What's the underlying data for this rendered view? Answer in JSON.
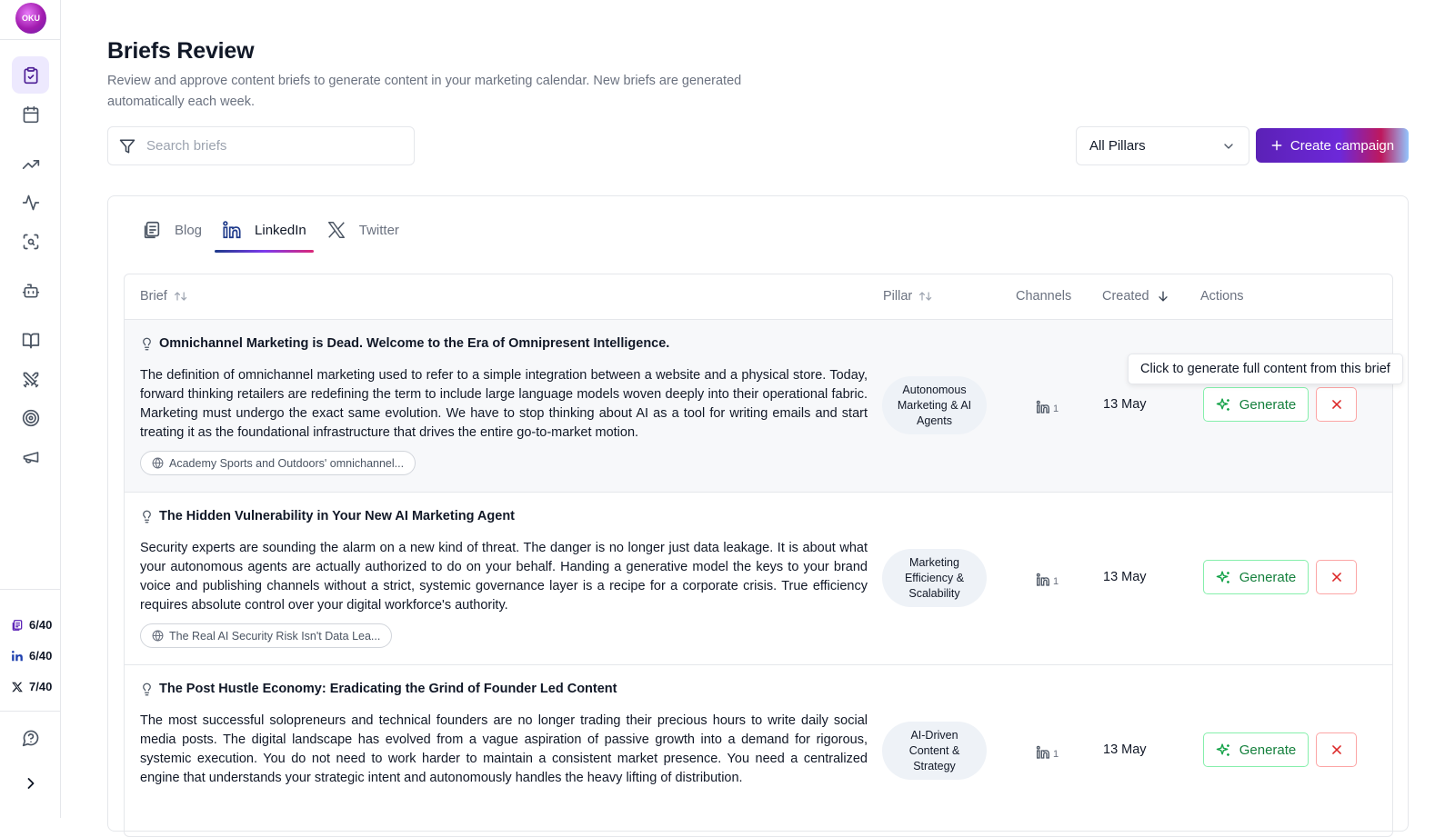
{
  "app": {
    "logo_text": "OKU"
  },
  "sidebar": {
    "nav": [
      {
        "name": "briefs",
        "icon": "clipboard-icon",
        "active": true
      },
      {
        "name": "calendar",
        "icon": "calendar-icon"
      },
      {
        "name": "trends",
        "icon": "trending-up-icon"
      },
      {
        "name": "activity",
        "icon": "activity-icon"
      },
      {
        "name": "scan",
        "icon": "scan-search-icon"
      },
      {
        "name": "agents",
        "icon": "bot-icon"
      },
      {
        "name": "library",
        "icon": "book-open-icon"
      },
      {
        "name": "tools",
        "icon": "swords-icon"
      },
      {
        "name": "goals",
        "icon": "target-icon"
      },
      {
        "name": "campaigns",
        "icon": "megaphone-icon"
      }
    ],
    "quotas": [
      {
        "icon": "blog-icon",
        "value": "6/40"
      },
      {
        "icon": "linkedin-icon",
        "value": "6/40"
      },
      {
        "icon": "x-icon",
        "value": "7/40"
      }
    ],
    "help_icon": "help-circle-icon",
    "expand_icon": "chevron-right-icon"
  },
  "header": {
    "title": "Briefs Review",
    "description": "Review and approve content briefs to generate content in your marketing calendar. New briefs are generated automatically each week."
  },
  "toolbar": {
    "search_placeholder": "Search briefs",
    "pillar_filter": "All Pillars",
    "create_label": "Create campaign"
  },
  "tabs": [
    {
      "label": "Blog",
      "icon": "blog-icon"
    },
    {
      "label": "LinkedIn",
      "icon": "linkedin-icon",
      "active": true
    },
    {
      "label": "Twitter",
      "icon": "x-icon"
    }
  ],
  "table": {
    "columns": {
      "brief": "Brief",
      "pillar": "Pillar",
      "channels": "Channels",
      "created": "Created",
      "actions": "Actions"
    },
    "generate_label": "Generate",
    "tooltip": "Click to generate full content from this brief",
    "rows": [
      {
        "title": "Omnichannel Marketing is Dead. Welcome to the Era of Omnipresent Intelligence.",
        "body": "The definition of omnichannel marketing used to refer to a simple integration between a website and a physical store. Today, forward thinking retailers are redefining the term to include large language models woven deeply into their operational fabric. Marketing must undergo the exact same evolution. We have to stop thinking about AI as a tool for writing emails and start treating it as the foundational infrastructure that drives the entire go-to-market motion.",
        "source": "Academy Sports and Outdoors' omnichannel...",
        "pillar": "Autonomous Marketing & AI Agents",
        "channel_count": "1",
        "created": "13 May"
      },
      {
        "title": "The Hidden Vulnerability in Your New AI Marketing Agent",
        "body": "Security experts are sounding the alarm on a new kind of threat. The danger is no longer just data leakage. It is about what your autonomous agents are actually authorized to do on your behalf. Handing a generative model the keys to your brand voice and publishing channels without a strict, systemic governance layer is a recipe for a corporate crisis. True efficiency requires absolute control over your digital workforce's authority.",
        "source": "The Real AI Security Risk Isn't Data Lea...",
        "pillar": "Marketing Efficiency & Scalability",
        "channel_count": "1",
        "created": "13 May"
      },
      {
        "title": "The Post Hustle Economy: Eradicating the Grind of Founder Led Content",
        "body": "The most successful solopreneurs and technical founders are no longer trading their precious hours to write daily social media posts. The digital landscape has evolved from a vague aspiration of passive growth into a demand for rigorous, systemic execution. You do not need to work harder to maintain a consistent market presence. You need a centralized engine that understands your strategic intent and autonomously handles the heavy lifting of distribution.",
        "source": "",
        "pillar": "AI-Driven Content & Strategy",
        "channel_count": "1",
        "created": "13 May"
      }
    ]
  },
  "colors": {
    "accent": "#5b21b6",
    "generate": "#15803d",
    "reject": "#dc2626"
  }
}
